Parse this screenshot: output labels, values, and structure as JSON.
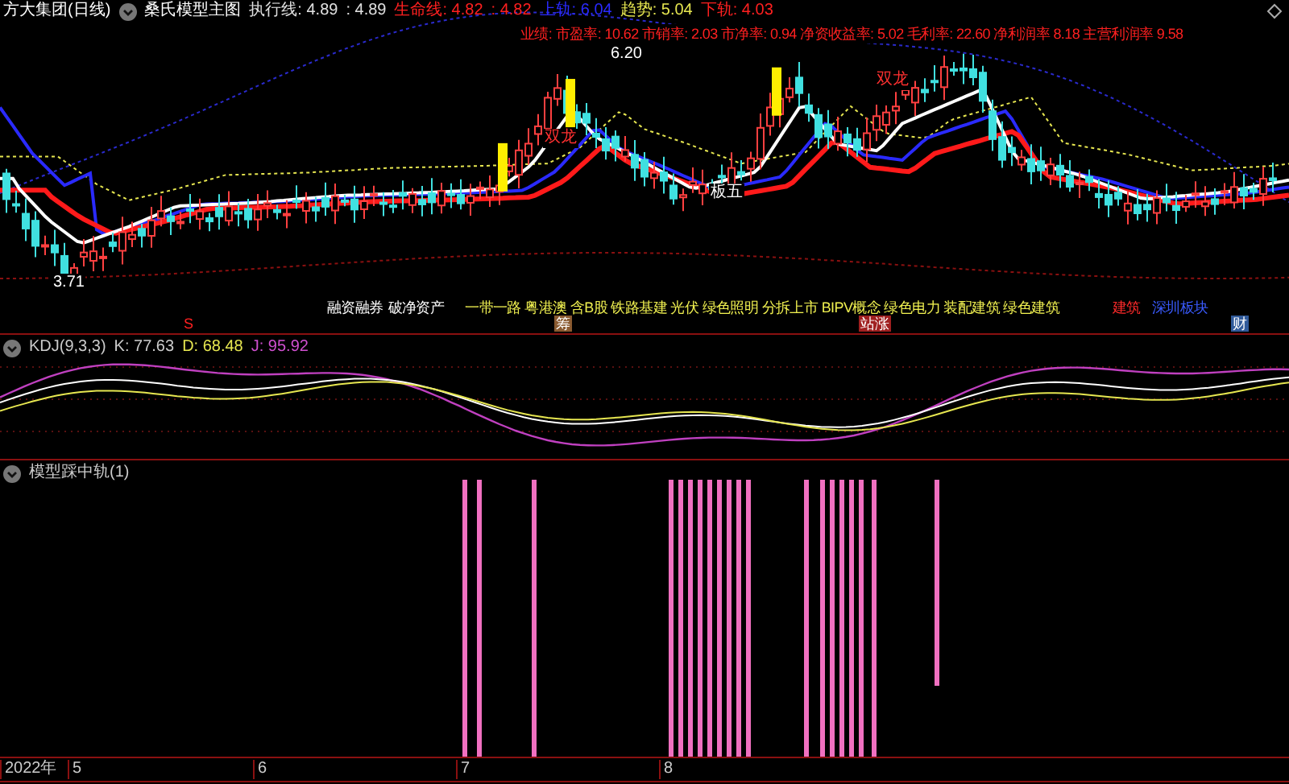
{
  "header": {
    "stock": "方大集团(日线)",
    "indicator": "桑氏模型主图",
    "lines": [
      {
        "label": "执行线: 4.89",
        "color": "#e0e0e0"
      },
      {
        "label": ": 4.89",
        "color": "#e0e0e0"
      },
      {
        "label": "生命线: 4.82",
        "color": "#ff2020"
      },
      {
        "label": ": 4.82",
        "color": "#ff2020"
      },
      {
        "label": "上轨: 6.04",
        "color": "#2a2aff"
      },
      {
        "label": "趋势: 5.04",
        "color": "#e6e650"
      },
      {
        "label": "下轨: 4.03",
        "color": "#ff2020"
      }
    ]
  },
  "fundamentals": "业绩: 市盈率: 10.62 市销率: 2.03 市净率: 0.94 净资收益率: 5.02 毛利率: 22.60 净利润率 8.18 主营利润率 9.58",
  "price_labels": [
    {
      "text": "6.20",
      "kind": "high"
    },
    {
      "text": "3.71",
      "kind": "low"
    },
    {
      "text": "板五",
      "kind": "note"
    },
    {
      "text": "双龙",
      "kind": "signal"
    },
    {
      "text": "双龙",
      "kind": "signal2"
    }
  ],
  "concept_tags": [
    {
      "text": "融资融券",
      "kind": "plain"
    },
    {
      "text": "破净资产",
      "kind": "plain"
    },
    {
      "text": "一带一路 粤港澳 含B股 铁路基建 光伏 绿色照明 分拆上市 BIPV概念 绿色电力 装配建筑 绿色建筑",
      "kind": "concept"
    },
    {
      "text": "建筑",
      "kind": "industry"
    },
    {
      "text": "深圳板块",
      "kind": "region"
    }
  ],
  "badges": [
    {
      "text": "S",
      "kind": "letter"
    },
    {
      "text": "筹",
      "kind": "brown"
    },
    {
      "text": "站涨",
      "kind": "red"
    },
    {
      "text": "财",
      "kind": "blue"
    }
  ],
  "kdj": {
    "name": "KDJ(9,3,3)",
    "k": "K: 77.63",
    "d": "D: 68.48",
    "j": "J: 95.92"
  },
  "model_panel": {
    "name": "模型踩中轨(1)"
  },
  "axis": [
    "2022年",
    "5",
    "6",
    "7",
    "8"
  ]
}
